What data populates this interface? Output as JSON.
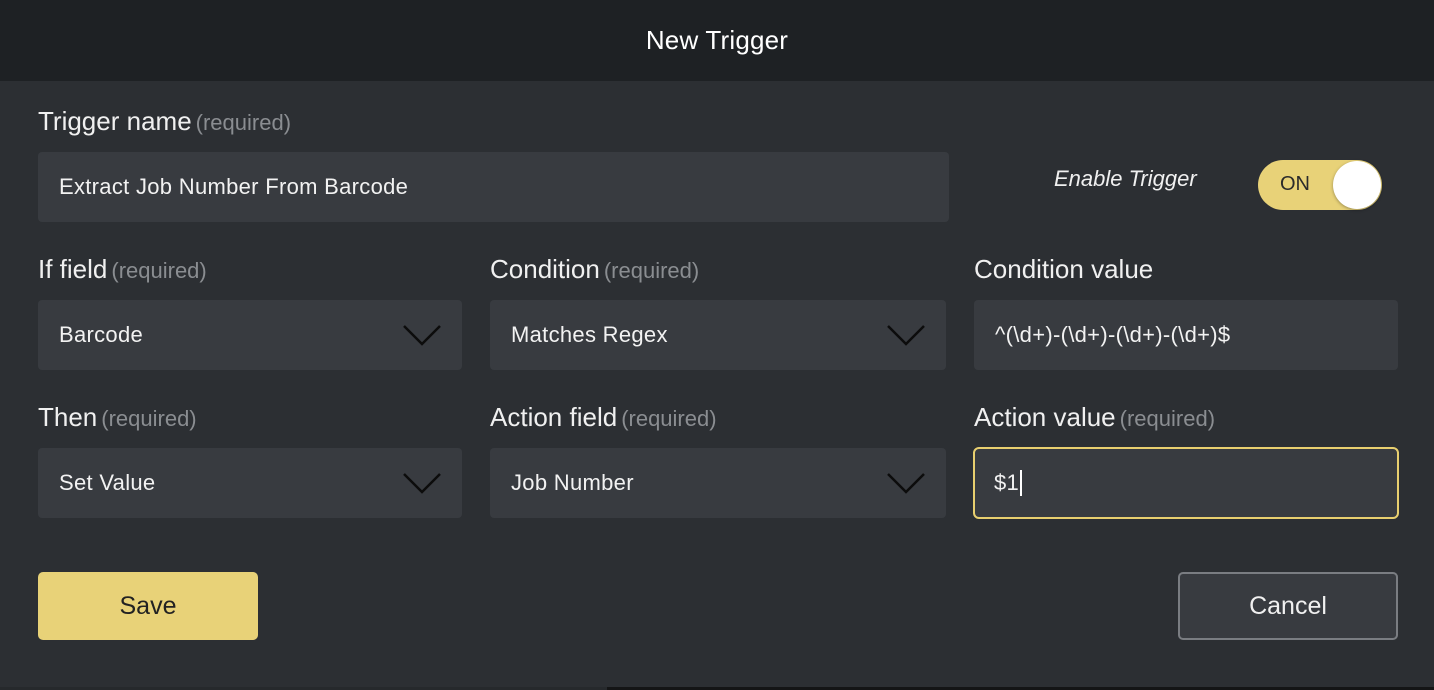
{
  "dialog": {
    "title": "New Trigger"
  },
  "form": {
    "required_hint": "(required)",
    "trigger_name": {
      "label": "Trigger name",
      "value": "Extract Job Number From Barcode"
    },
    "enable_trigger": {
      "label": "Enable Trigger",
      "state_text": "ON",
      "enabled": true
    },
    "if_field": {
      "label": "If field",
      "value": "Barcode"
    },
    "condition": {
      "label": "Condition",
      "value": "Matches Regex"
    },
    "condition_value": {
      "label": "Condition value",
      "value": "^(\\d+)-(\\d+)-(\\d+)-(\\d+)$"
    },
    "then": {
      "label": "Then",
      "value": "Set Value"
    },
    "action_field": {
      "label": "Action field",
      "value": "Job Number"
    },
    "action_value": {
      "label": "Action value",
      "value": "$1"
    }
  },
  "buttons": {
    "save": "Save",
    "cancel": "Cancel"
  },
  "colors": {
    "accent": "#e8d278",
    "header_bg": "#1e2124",
    "panel_bg": "#2c2f33",
    "field_bg": "#383b40",
    "focus_border": "#e8cf6f"
  },
  "icons": {
    "dropdown": "chevron-down-icon"
  }
}
